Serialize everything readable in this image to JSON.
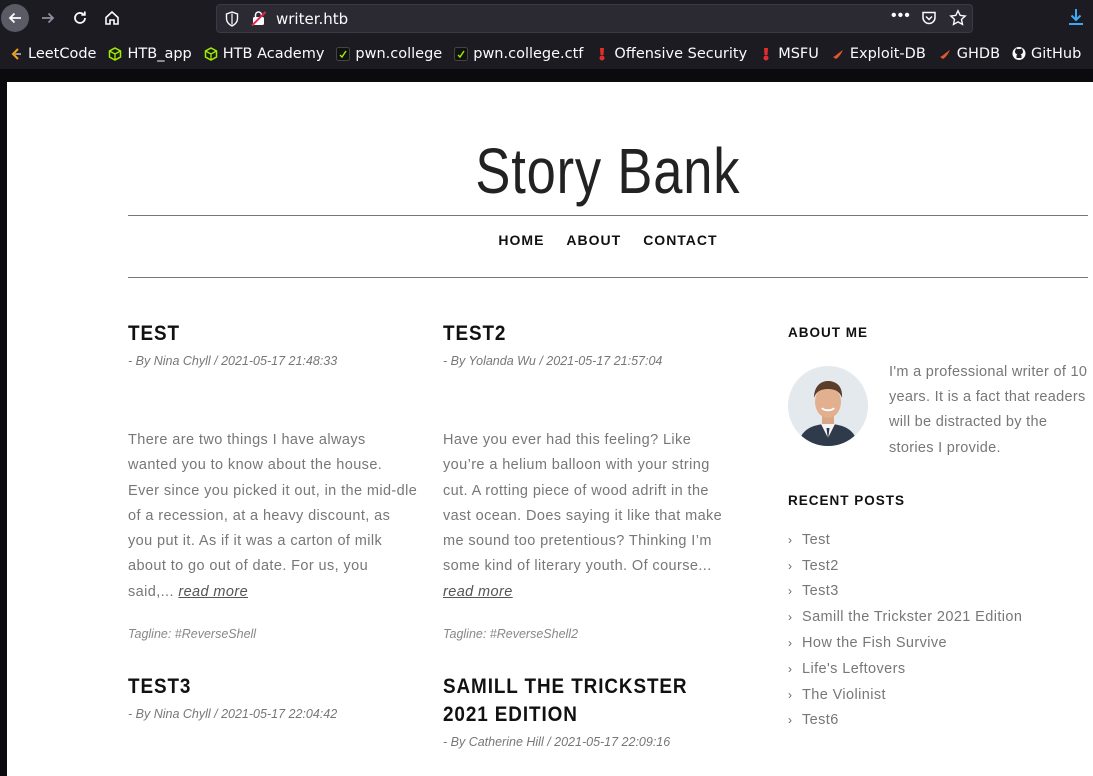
{
  "browser": {
    "url": "writer.htb",
    "bookmarks": [
      {
        "label": "LeetCode",
        "icon": "leetcode-icon",
        "color": "#f89f1b"
      },
      {
        "label": "HTB_app",
        "icon": "htb-cube-icon",
        "color": "#9fef00"
      },
      {
        "label": "HTB Academy",
        "icon": "htb-cube-icon",
        "color": "#9fef00"
      },
      {
        "label": "pwn.college",
        "icon": "pwn-college-icon",
        "color": "#000000"
      },
      {
        "label": "pwn.college.ctf",
        "icon": "pwn-college-icon",
        "color": "#000000"
      },
      {
        "label": "Offensive Security",
        "icon": "offsec-icon",
        "color": "#e02d2d"
      },
      {
        "label": "MSFU",
        "icon": "offsec-icon",
        "color": "#e02d2d"
      },
      {
        "label": "Exploit-DB",
        "icon": "exploitdb-icon",
        "color": "#e2572b"
      },
      {
        "label": "GHDB",
        "icon": "exploitdb-icon",
        "color": "#e2572b"
      },
      {
        "label": "GitHub",
        "icon": "github-icon",
        "color": "#fbfbfe"
      }
    ]
  },
  "site": {
    "title": "Story Bank",
    "menu": [
      "HOME",
      "ABOUT",
      "CONTACT"
    ]
  },
  "posts": [
    {
      "title": "TEST",
      "meta": "- By Nina Chyll / 2021-05-17 21:48:33",
      "body": "There are two things I have always wanted you to know about the house. Ever since you picked it out, in the mid-dle of a recession, at a heavy discount, as you put it. As if it was a carton of milk about to go out of date. For us, you said,...",
      "read_more": "read more",
      "tagline": "Tagline: #ReverseShell"
    },
    {
      "title": "TEST2",
      "meta": "- By Yolanda Wu / 2021-05-17 21:57:04",
      "body": "Have you ever had this feeling? Like you’re a helium balloon with your string cut. A rotting piece of wood adrift in the vast ocean. Does saying it like that make me sound too pretentious? Thinking I’m some kind of literary youth. Of course...",
      "read_more": "read more",
      "tagline": "Tagline: #ReverseShell2"
    },
    {
      "title": "TEST3",
      "meta": "- By Nina Chyll / 2021-05-17 22:04:42"
    },
    {
      "title": "SAMILL THE TRICKSTER 2021 EDITION",
      "meta": "- By Catherine Hill / 2021-05-17 22:09:16"
    }
  ],
  "sidebar": {
    "about_heading": "ABOUT ME",
    "about_text": "I'm a professional writer of 10 years. It is a fact that readers will be distracted by the stories I provide.",
    "recent_heading": "RECENT POSTS",
    "recent_posts": [
      "Test",
      "Test2",
      "Test3",
      "Samill the Trickster 2021 Edition",
      "How the Fish Survive",
      "Life's Leftovers",
      "The Violinist",
      "Test6"
    ]
  }
}
